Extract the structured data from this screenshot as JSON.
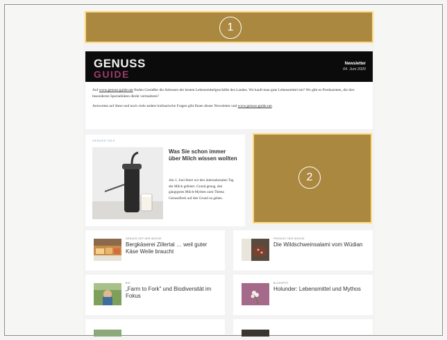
{
  "ads": [
    {
      "number": "1",
      "color": "#aa8840"
    },
    {
      "number": "2",
      "color": "#aa8840"
    }
  ],
  "header": {
    "brand_line1": "GENUSS",
    "brand_line2": "GUIDE",
    "brand_accent": "#9e3b6c",
    "label": "Newsletter",
    "date": "04. Juni 2020"
  },
  "intro": {
    "p1_before_link": "Auf ",
    "p1_link": "www.genuss-guide.net",
    "p1_after_link": " finden Genießer die Adressen der besten Lebensmittelgeschäfte des Landes. Wo kauft man gute Lebensmittel ein? Wo gibt es Produzenten, die ihre besonderen Spezialitäten direkt vermarkten?",
    "p2_before_link": "Antworten auf diese und noch viele andere kulinarische Fragen gibt Ihnen dieser Newsletter und ",
    "p2_link": "www.genuss-guide.net",
    "p2_after_link": "."
  },
  "feature": {
    "tag": "GENUSS TALK",
    "tag_color": "#6aa0c8",
    "title": "Was Sie schon immer über Milch wissen wollten",
    "text": "Am 1. Juni feiert wir den internationalen Tag der Milch gefeiert. Grund genug, den gängigsten Milch-Mythen zum Thema Genussfleck auf den Grund zu gehen."
  },
  "cards": [
    {
      "tag": "GENUSS-ORT DER WOCHE",
      "title": "Bergkäserei Zillertal … weil guter Käse Weile braucht"
    },
    {
      "tag": "PRODUKT DER WOCHE",
      "title": "Die Wildschweinsalami vom Wüdian"
    },
    {
      "tag": "BIO",
      "title": "„Farm to Fork\" und Biodiversität im Fokus"
    },
    {
      "tag": "BLOGSPOT",
      "title": "Holunder: Lebensmittel und Mythos"
    }
  ]
}
